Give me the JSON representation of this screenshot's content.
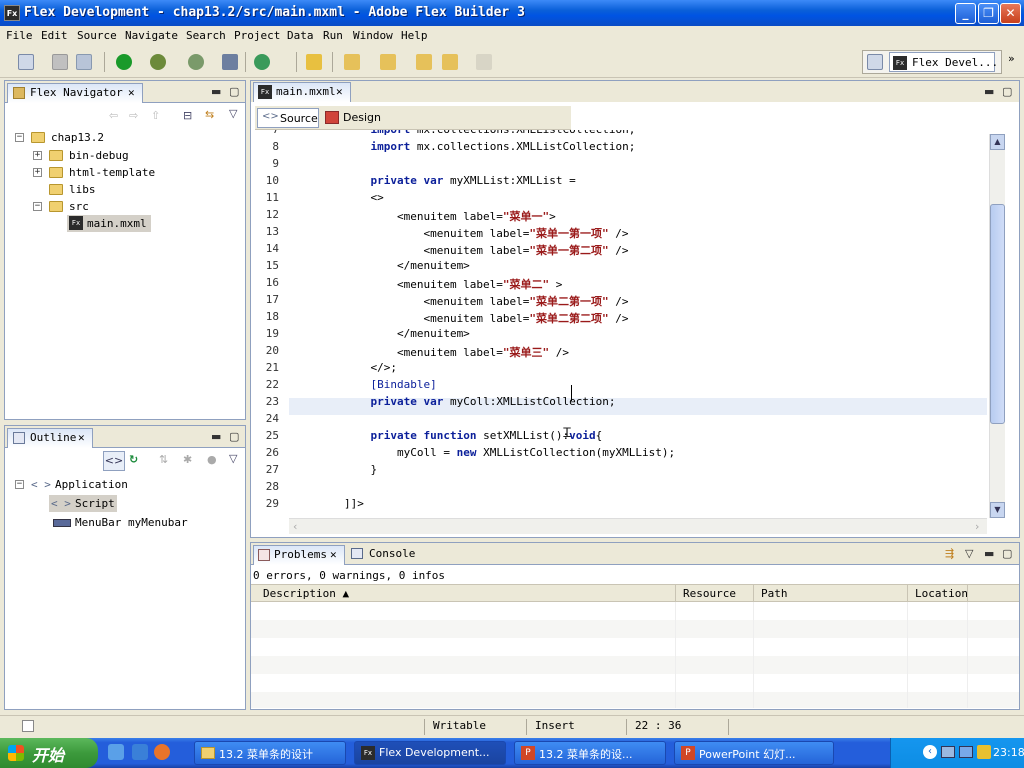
{
  "window": {
    "title": "Flex Development - chap13.2/src/main.mxml - Adobe Flex Builder 3",
    "app_icon": "Fx"
  },
  "menu": [
    "File",
    "Edit",
    "Source",
    "Navigate",
    "Search",
    "Project",
    "Data",
    "Run",
    "Window",
    "Help"
  ],
  "perspective": {
    "label": "Flex Devel..."
  },
  "navigator": {
    "title": "Flex Navigator",
    "tree": [
      {
        "label": "chap13.2",
        "level": 0,
        "expanded": true
      },
      {
        "label": "bin-debug",
        "level": 1,
        "expander": "+"
      },
      {
        "label": "html-template",
        "level": 1,
        "expander": "+"
      },
      {
        "label": "libs",
        "level": 1,
        "expander": ""
      },
      {
        "label": "src",
        "level": 1,
        "expander": "-"
      },
      {
        "label": "main.mxml",
        "level": 2,
        "expander": "",
        "selected": true
      }
    ]
  },
  "outline": {
    "title": "Outline",
    "tree": [
      {
        "label": "Application",
        "level": 0
      },
      {
        "label": "Script",
        "level": 1,
        "selected": true
      },
      {
        "label": "MenuBar myMenubar",
        "level": 1
      }
    ]
  },
  "editor": {
    "tab": "main.mxml",
    "source_label": "Source",
    "design_label": "Design",
    "lines": [
      {
        "n": "7",
        "text": "            import mx.collections.XMLListCollection;"
      },
      {
        "n": "8",
        "text": "            import mx.collections.XMLListCollection;"
      },
      {
        "n": "9",
        "text": ""
      },
      {
        "n": "10",
        "text": "            private var myXMLList:XMLList ="
      },
      {
        "n": "11",
        "text": "            <>"
      },
      {
        "n": "12",
        "text": "                <menuitem label=\"菜单一\">"
      },
      {
        "n": "13",
        "text": "                    <menuitem label=\"菜单一第一项\" />"
      },
      {
        "n": "14",
        "text": "                    <menuitem label=\"菜单一第二项\" />"
      },
      {
        "n": "15",
        "text": "                </menuitem>"
      },
      {
        "n": "16",
        "text": "                <menuitem label=\"菜单二\" >"
      },
      {
        "n": "17",
        "text": "                    <menuitem label=\"菜单二第一项\" />"
      },
      {
        "n": "18",
        "text": "                    <menuitem label=\"菜单二第二项\" />"
      },
      {
        "n": "19",
        "text": "                </menuitem>"
      },
      {
        "n": "20",
        "text": "                <menuitem label=\"菜单三\" />"
      },
      {
        "n": "21",
        "text": "            </>;"
      },
      {
        "n": "22",
        "text": "            [Bindable]"
      },
      {
        "n": "23",
        "text": "            private var myColl:XMLListCollection;"
      },
      {
        "n": "24",
        "text": ""
      },
      {
        "n": "25",
        "text": "            private function setXMLList():void{"
      },
      {
        "n": "26",
        "text": "                myColl = new XMLListCollection(myXMLList);"
      },
      {
        "n": "27",
        "text": "            }"
      },
      {
        "n": "28",
        "text": ""
      },
      {
        "n": "29",
        "text": "        ]]>"
      }
    ]
  },
  "problems": {
    "tab": "Problems",
    "console_tab": "Console",
    "summary": "0 errors, 0 warnings, 0 infos",
    "columns": [
      "Description",
      "Resource",
      "Path",
      "Location"
    ]
  },
  "status": {
    "writable": "Writable",
    "insert": "Insert",
    "position": "22 : 36"
  },
  "taskbar": {
    "start": "开始",
    "tasks": [
      "13.2 菜单条的设计",
      "Flex Development...",
      "13.2 菜单条的设...",
      "PowerPoint 幻灯..."
    ],
    "clock": "23:18"
  }
}
